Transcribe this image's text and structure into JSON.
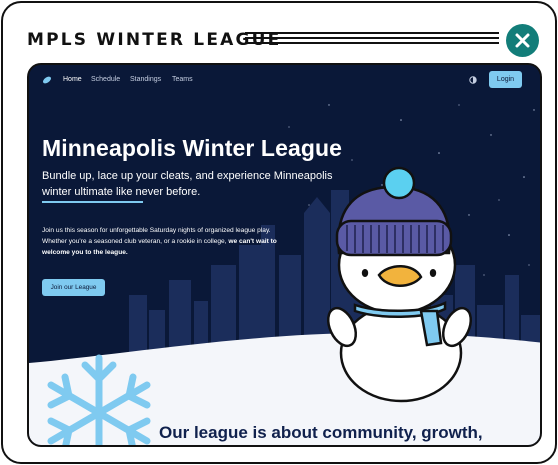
{
  "header": {
    "title": "MPLS WINTER LEAGUE",
    "close_icon": "close-icon"
  },
  "nav": {
    "logo_icon": "disc-icon",
    "links": [
      {
        "label": "Home",
        "active": true
      },
      {
        "label": "Schedule",
        "active": false
      },
      {
        "label": "Standings",
        "active": false
      },
      {
        "label": "Teams",
        "active": false
      }
    ],
    "theme_icon": "contrast-icon",
    "login_label": "Login"
  },
  "hero": {
    "title": "Minneapolis Winter League",
    "subtitle": "Bundle up, lace up your cleats, and experience Minneapolis winter ultimate like never before.",
    "body_text": "Join us this season for unforgettable Saturday nights of organized league play. Whether you're a seasoned club veteran, or a rookie in college, ",
    "body_bold": "we can't wait to welcome you to the league.",
    "cta_label": "Join our League"
  },
  "mission": {
    "heading_visible": "Our league is about community, growth,"
  },
  "colors": {
    "night_sky": "#0a1838",
    "accent": "#7fcaf0",
    "close_button": "#127d79",
    "heading_dark": "#10214d"
  }
}
